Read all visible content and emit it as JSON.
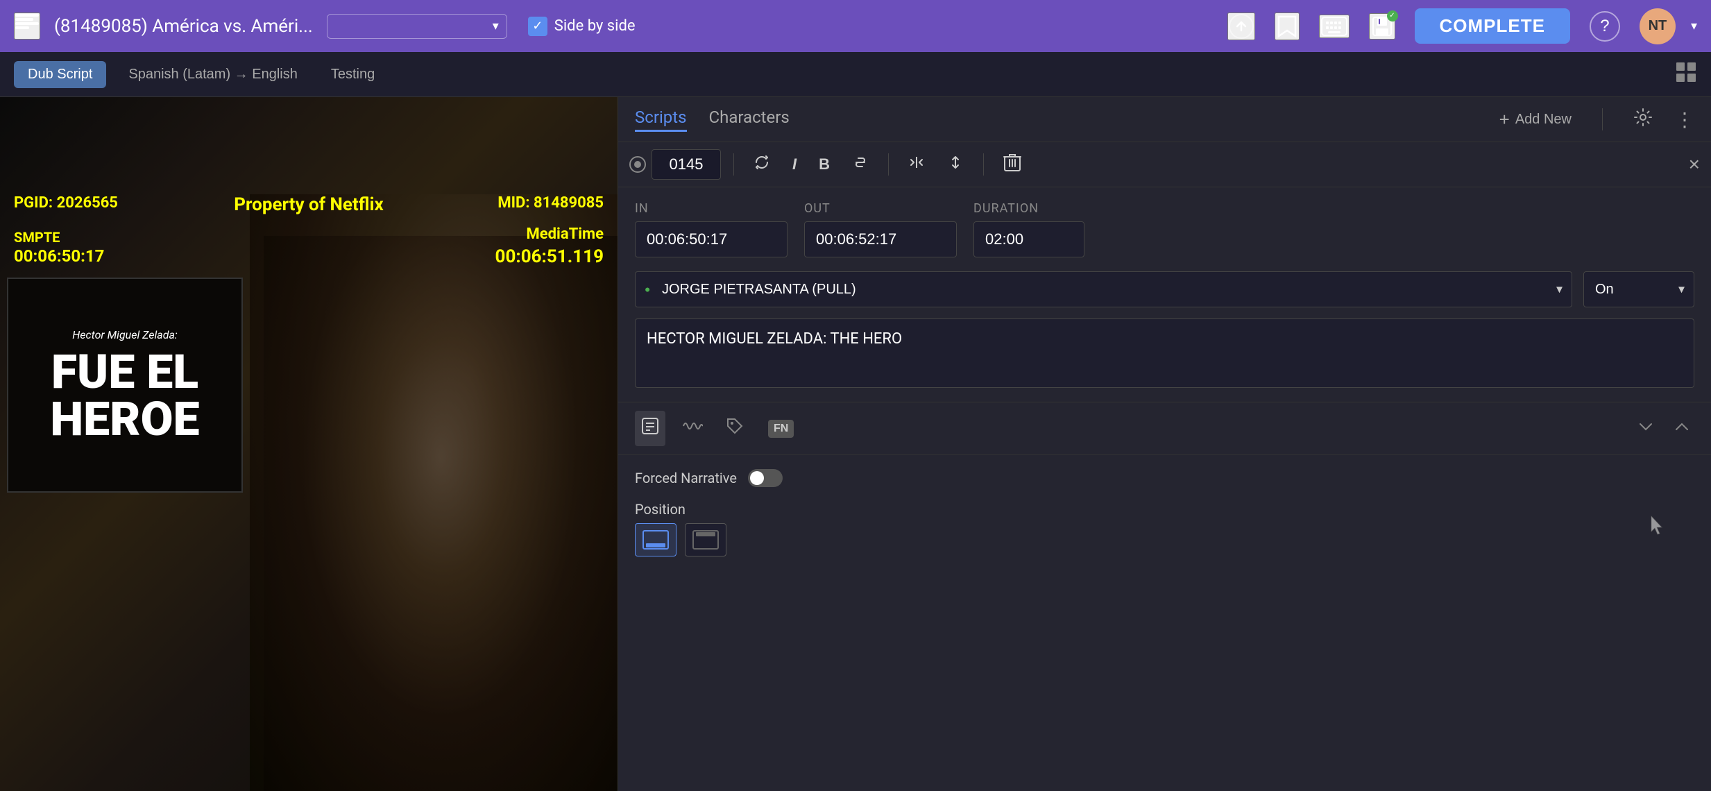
{
  "header": {
    "hamburger_label": "☰",
    "project_title": "(81489085) América vs. Améri...",
    "episode_placeholder": "",
    "side_by_side_label": "Side by side",
    "upload_icon": "⬆",
    "bookmark_icon": "🔖",
    "keyboard_icon": "⌨",
    "save_icon": "💾",
    "save_badge": "✓",
    "complete_label": "COMPLETE",
    "help_icon": "?",
    "avatar_label": "NT",
    "dropdown_arrow": "▾"
  },
  "toolbar": {
    "dub_script_label": "Dub Script",
    "language_label": "Spanish (Latam) → English",
    "testing_label": "Testing",
    "grid_icon": "⊞"
  },
  "right_panel": {
    "tabs": {
      "scripts_label": "Scripts",
      "characters_label": "Characters"
    },
    "add_new_label": "Add New",
    "add_icon": "+",
    "settings_icon": "⚙",
    "more_icon": "⋮"
  },
  "subtitle_editor": {
    "subtitle_number": "0145",
    "rotate_icon": "↻",
    "italic_icon": "I",
    "bold_icon": "B",
    "strikethrough_icon": "S̶",
    "split_icon": "⊣",
    "merge_icon": "⊢",
    "delete_icon": "🗑",
    "close_icon": "×",
    "in_label": "IN",
    "out_label": "OUT",
    "duration_label": "DURATION",
    "in_value": "00:06:50:17",
    "out_value": "00:06:52:17",
    "duration_value": "02:00",
    "character_name": "JORGE PIETRASANTA (PULL)",
    "on_value": "On",
    "subtitle_text": "HECTOR MIGUEL ZELADA: THE HERO",
    "forced_narrative_label": "Forced Narrative",
    "forced_narrative_on": false,
    "position_label": "Position"
  },
  "video": {
    "pgid_label": "PGID:",
    "pgid_value": "2026565",
    "property_text": "Property of Netflix",
    "mid_label": "MID:",
    "mid_value": "81489085",
    "smpte_label": "SMPTE",
    "smpte_time": "00:06:50:17",
    "media_time_label": "MediaTime",
    "media_time_value": "00:06:51.119",
    "card_title": "Hector Miguel Zelada:",
    "card_main_text_1": "FUE EL",
    "card_main_text_2": "HEROE"
  }
}
